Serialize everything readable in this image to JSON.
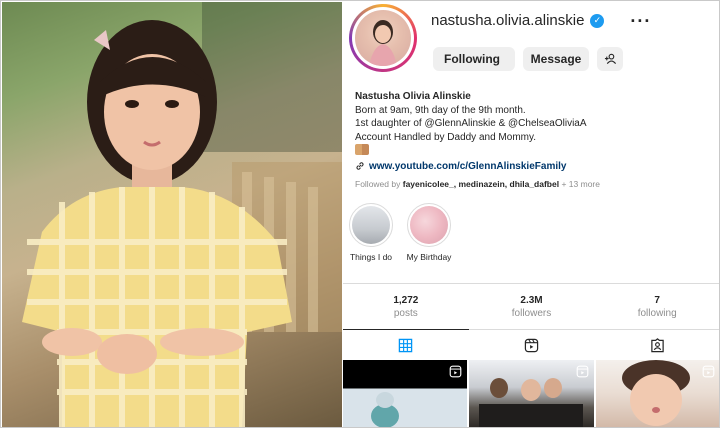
{
  "profile": {
    "username": "nastusha.olivia.alinskie",
    "verified": true,
    "buttons": {
      "following": "Following",
      "message": "Message"
    },
    "bio": {
      "name": "Nastusha Olivia Alinskie",
      "line1": "Born at 9am, 9th day of the 9th month.",
      "line2": "1st daughter of @GlennAlinskie & @ChelseaOliviaA",
      "line3": "Account Handled by Daddy and Mommy.",
      "link": "www.youtube.com/c/GlennAlinskieFamily"
    },
    "followed_by": {
      "prefix": "Followed by",
      "names": "fayenicolee_, medinazein, dhila_dafbel",
      "more": "+ 13 more"
    },
    "highlights": [
      {
        "label": "Things I do"
      },
      {
        "label": "My Birthday"
      }
    ],
    "stats": [
      {
        "value": "1,272",
        "label": "posts"
      },
      {
        "value": "2.3M",
        "label": "followers"
      },
      {
        "value": "7",
        "label": "following"
      }
    ]
  },
  "colors": {
    "verified": "#1d9bf0",
    "link": "#00376b",
    "muted": "#8e8e8e"
  },
  "icons": [
    "verified-badge-icon",
    "more-options-icon",
    "chevron-down-icon",
    "add-person-icon",
    "link-icon",
    "grid-icon",
    "reels-icon",
    "tagged-icon",
    "reel-overlay-icon"
  ]
}
